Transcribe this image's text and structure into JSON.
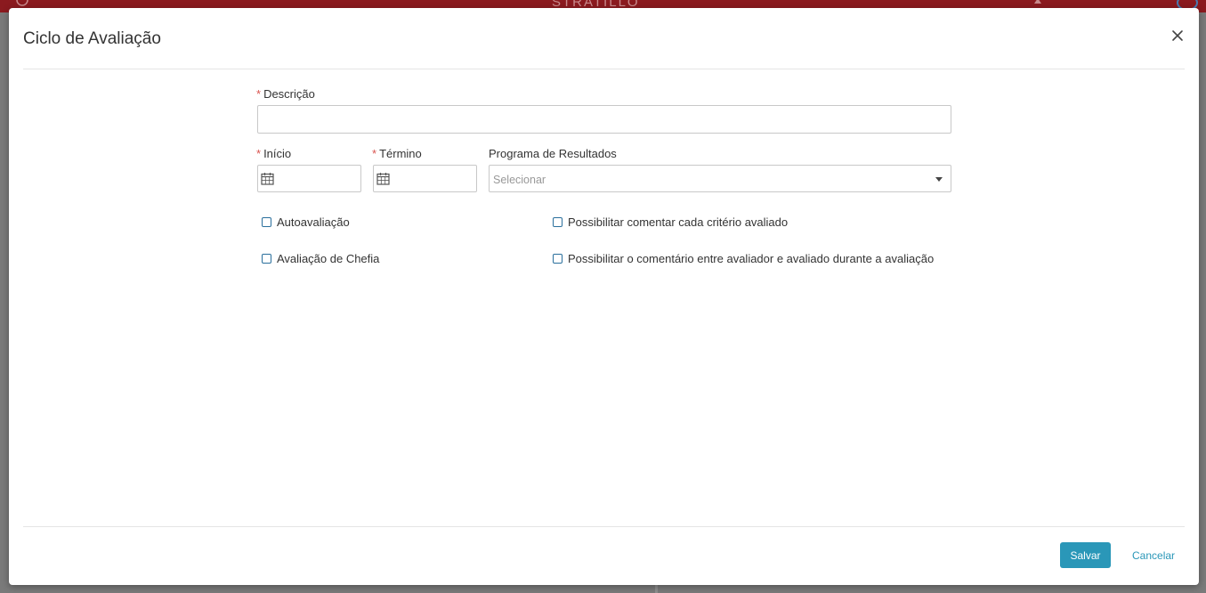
{
  "topbar": {
    "brand": "STRATILLO"
  },
  "modal": {
    "title": "Ciclo de Avaliação",
    "form": {
      "required_mark": "*",
      "descricao": {
        "label": "Descrição",
        "value": ""
      },
      "inicio": {
        "label": "Início",
        "value": ""
      },
      "termino": {
        "label": "Término",
        "value": ""
      },
      "programa": {
        "label": "Programa de Resultados",
        "placeholder": "Selecionar"
      }
    },
    "checkboxes": [
      {
        "label": "Autoavaliação",
        "checked": false
      },
      {
        "label": "Possibilitar comentar cada critério avaliado",
        "checked": false
      },
      {
        "label": "Avaliação de Chefia",
        "checked": false
      },
      {
        "label": "Possibilitar o comentário entre avaliador e avaliado durante a avaliação",
        "checked": false
      }
    ],
    "footer": {
      "save_label": "Salvar",
      "cancel_label": "Cancelar"
    }
  },
  "icons": {
    "close": "close-icon",
    "calendar": "calendar-icon",
    "dropdown": "chevron-down-icon"
  },
  "colors": {
    "topbar": "#8b1a1f",
    "primary": "#2a97b8",
    "required": "#d9534f",
    "checkbox_border": "#2a6f9c"
  }
}
